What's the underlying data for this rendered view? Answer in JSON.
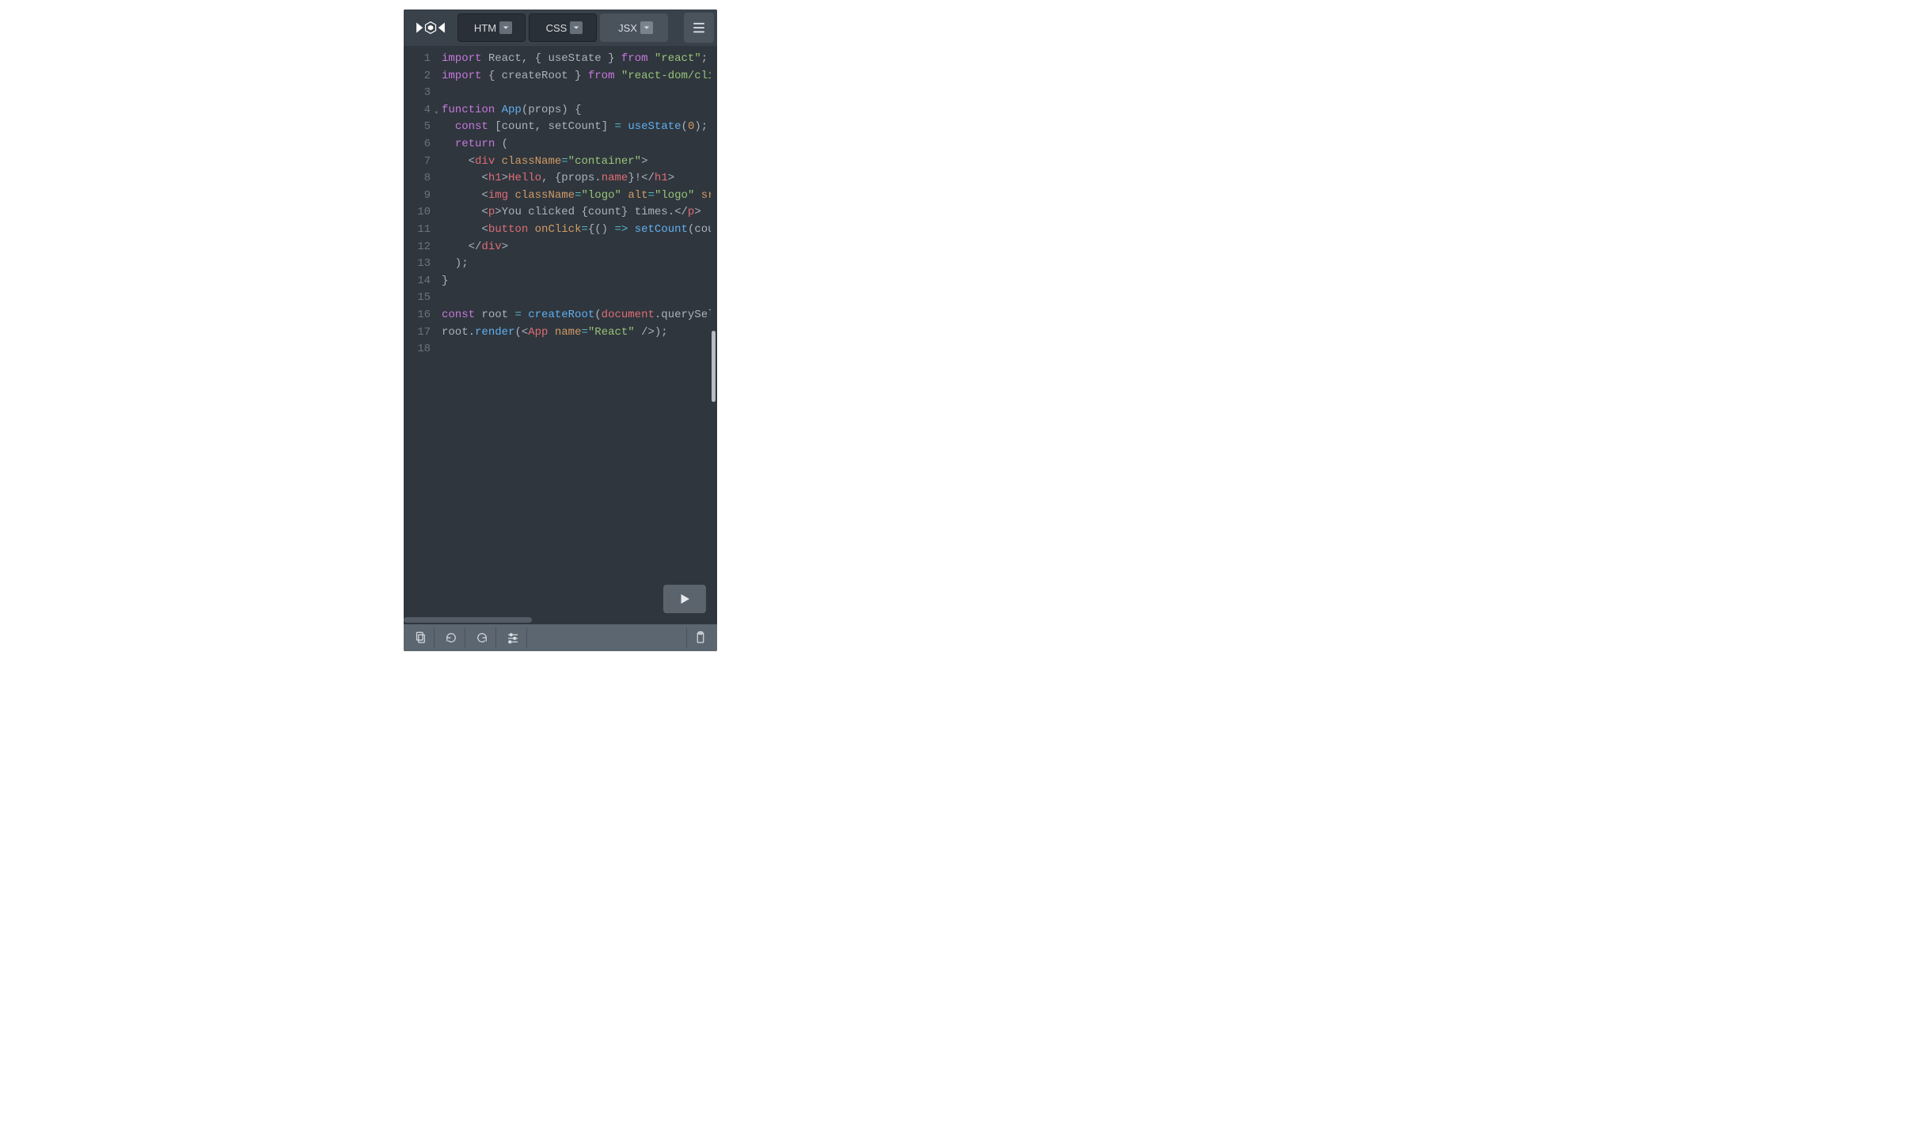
{
  "header": {
    "tabs": [
      {
        "label": "HTM",
        "active": false
      },
      {
        "label": "CSS",
        "active": false
      },
      {
        "label": "JSX",
        "active": true
      }
    ]
  },
  "editor": {
    "line_numbers": [
      "1",
      "2",
      "3",
      "4",
      "5",
      "6",
      "7",
      "8",
      "9",
      "10",
      "11",
      "12",
      "13",
      "14",
      "15",
      "16",
      "17",
      "18"
    ],
    "fold_line": 4,
    "code": {
      "1": [
        [
          "k",
          "import"
        ],
        [
          "p",
          " "
        ],
        [
          "id",
          "React"
        ],
        [
          "p",
          ", { "
        ],
        [
          "id",
          "useState"
        ],
        [
          "p",
          " } "
        ],
        [
          "k",
          "from"
        ],
        [
          "p",
          " "
        ],
        [
          "s",
          "\"react\""
        ],
        [
          "p",
          ";"
        ]
      ],
      "2": [
        [
          "k",
          "import"
        ],
        [
          "p",
          " { "
        ],
        [
          "id",
          "createRoot"
        ],
        [
          "p",
          " } "
        ],
        [
          "k",
          "from"
        ],
        [
          "p",
          " "
        ],
        [
          "s",
          "\"react-dom/cli"
        ]
      ],
      "3": [],
      "4": [
        [
          "k",
          "function"
        ],
        [
          "p",
          " "
        ],
        [
          "fn",
          "App"
        ],
        [
          "p",
          "("
        ],
        [
          "id",
          "props"
        ],
        [
          "p",
          ") {"
        ]
      ],
      "5": [
        [
          "p",
          "  "
        ],
        [
          "k",
          "const"
        ],
        [
          "p",
          " ["
        ],
        [
          "id",
          "count"
        ],
        [
          "p",
          ", "
        ],
        [
          "id",
          "setCount"
        ],
        [
          "p",
          "] "
        ],
        [
          "op",
          "="
        ],
        [
          "p",
          " "
        ],
        [
          "fn",
          "useState"
        ],
        [
          "p",
          "("
        ],
        [
          "n",
          "0"
        ],
        [
          "p",
          ");"
        ]
      ],
      "6": [
        [
          "p",
          "  "
        ],
        [
          "k",
          "return"
        ],
        [
          "p",
          " ("
        ]
      ],
      "7": [
        [
          "p",
          "    "
        ],
        [
          "p",
          "<"
        ],
        [
          "tg",
          "div"
        ],
        [
          "p",
          " "
        ],
        [
          "at",
          "className"
        ],
        [
          "op",
          "="
        ],
        [
          "s",
          "\"container\""
        ],
        [
          "p",
          ">"
        ]
      ],
      "8": [
        [
          "p",
          "      "
        ],
        [
          "p",
          "<"
        ],
        [
          "tg",
          "h1"
        ],
        [
          "p",
          ">"
        ],
        [
          "pr",
          "Hello"
        ],
        [
          "p",
          ", {"
        ],
        [
          "id",
          "props"
        ],
        [
          "p",
          "."
        ],
        [
          "pr",
          "name"
        ],
        [
          "p",
          "}!</"
        ],
        [
          "tg",
          "h1"
        ],
        [
          "p",
          ">"
        ]
      ],
      "9": [
        [
          "p",
          "      "
        ],
        [
          "p",
          "<"
        ],
        [
          "tg",
          "img"
        ],
        [
          "p",
          " "
        ],
        [
          "at",
          "className"
        ],
        [
          "op",
          "="
        ],
        [
          "s",
          "\"logo\""
        ],
        [
          "p",
          " "
        ],
        [
          "at",
          "alt"
        ],
        [
          "op",
          "="
        ],
        [
          "s",
          "\"logo\""
        ],
        [
          "p",
          " "
        ],
        [
          "at",
          "sr"
        ]
      ],
      "10": [
        [
          "p",
          "      "
        ],
        [
          "p",
          "<"
        ],
        [
          "tg",
          "p"
        ],
        [
          "p",
          ">"
        ],
        [
          "tx",
          "You clicked "
        ],
        [
          "p",
          "{"
        ],
        [
          "id",
          "count"
        ],
        [
          "p",
          "}"
        ],
        [
          "tx",
          " times."
        ],
        [
          "p",
          "</"
        ],
        [
          "tg",
          "p"
        ],
        [
          "p",
          ">"
        ]
      ],
      "11": [
        [
          "p",
          "      "
        ],
        [
          "p",
          "<"
        ],
        [
          "tg",
          "button"
        ],
        [
          "p",
          " "
        ],
        [
          "at",
          "onClick"
        ],
        [
          "op",
          "="
        ],
        [
          "p",
          "{"
        ],
        [
          "p",
          "() "
        ],
        [
          "op",
          "=>"
        ],
        [
          "p",
          " "
        ],
        [
          "fn",
          "setCount"
        ],
        [
          "p",
          "("
        ],
        [
          "id",
          "cou"
        ]
      ],
      "12": [
        [
          "p",
          "    "
        ],
        [
          "p",
          "</"
        ],
        [
          "tg",
          "div"
        ],
        [
          "p",
          ">"
        ]
      ],
      "13": [
        [
          "p",
          "  );"
        ]
      ],
      "14": [
        [
          "p",
          "}"
        ]
      ],
      "15": [],
      "16": [
        [
          "k",
          "const"
        ],
        [
          "p",
          " "
        ],
        [
          "id",
          "root"
        ],
        [
          "p",
          " "
        ],
        [
          "op",
          "="
        ],
        [
          "p",
          " "
        ],
        [
          "fn",
          "createRoot"
        ],
        [
          "p",
          "("
        ],
        [
          "pr",
          "document"
        ],
        [
          "p",
          "."
        ],
        [
          "id",
          "querySel"
        ]
      ],
      "17": [
        [
          "id",
          "root"
        ],
        [
          "p",
          "."
        ],
        [
          "fn",
          "render"
        ],
        [
          "p",
          "(<"
        ],
        [
          "tg",
          "App"
        ],
        [
          "p",
          " "
        ],
        [
          "at",
          "name"
        ],
        [
          "op",
          "="
        ],
        [
          "s",
          "\"React\""
        ],
        [
          "p",
          " />);"
        ]
      ],
      "18": []
    }
  },
  "icons": {
    "logo": "jsfiddle-logo",
    "menu": "hamburger-menu",
    "run": "play",
    "footer": [
      "copy",
      "reload-ccw",
      "reload-cw",
      "sliders",
      "clipboard"
    ]
  }
}
